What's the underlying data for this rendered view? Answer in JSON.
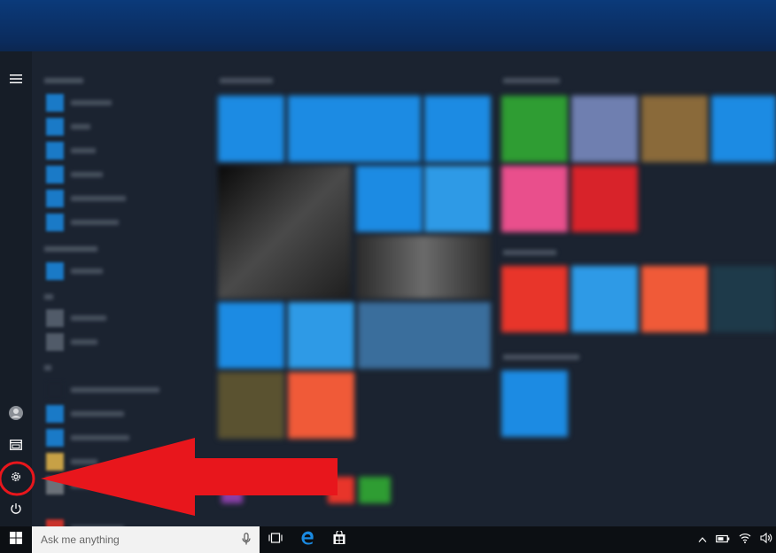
{
  "taskbar": {
    "search_placeholder": "Ask me anything"
  },
  "rail": {
    "items": [
      "menu-icon",
      "user-icon",
      "file-explorer-icon",
      "gear-icon",
      "power-icon"
    ]
  },
  "annotation": {
    "highlight_color": "#e8161c",
    "target": "settings-button"
  },
  "colors": {
    "tile_blue": "#1c8be3",
    "tile_light_blue": "#2e9ae6",
    "tile_green": "#2f9d33",
    "tile_red": "#e8352a",
    "tile_orange": "#f05a38",
    "menu_bg": "#1b2330"
  }
}
